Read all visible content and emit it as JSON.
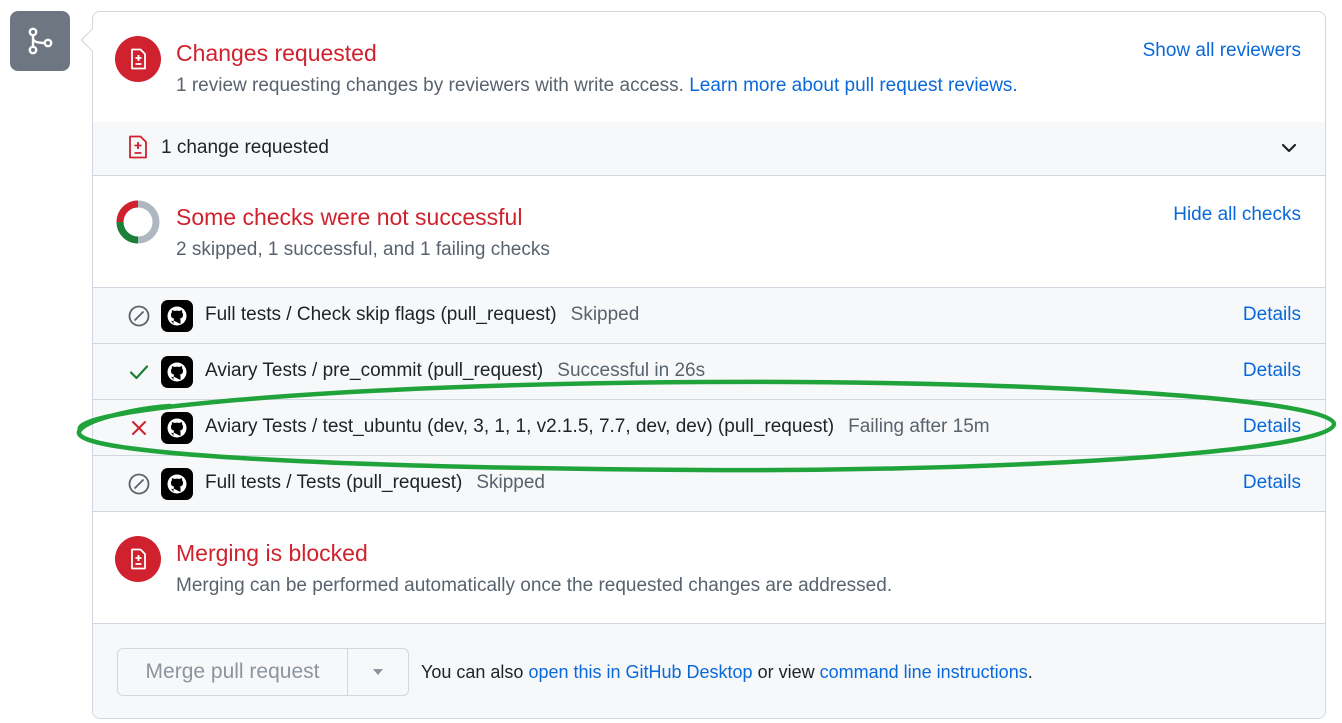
{
  "review": {
    "title": "Changes requested",
    "subtitle": "1 review requesting changes by reviewers with write access.",
    "learn_more": "Learn more about pull request reviews.",
    "show_all": "Show all reviewers",
    "changes_row": "1 change requested"
  },
  "checks_summary": {
    "title": "Some checks were not successful",
    "subtitle": "2 skipped, 1 successful, and 1 failing checks",
    "hide_all": "Hide all checks"
  },
  "checks": [
    {
      "name": "Full tests / Check skip flags (pull_request)",
      "note": "Skipped",
      "status": "skipped",
      "details": "Details"
    },
    {
      "name": "Aviary Tests / pre_commit (pull_request)",
      "note": "Successful in 26s",
      "status": "success",
      "details": "Details"
    },
    {
      "name": "Aviary Tests / test_ubuntu (dev, 3, 1, 1, v2.1.5, 7.7, dev, dev) (pull_request)",
      "note": "Failing after 15m",
      "status": "failure",
      "details": "Details"
    },
    {
      "name": "Full tests / Tests (pull_request)",
      "note": "Skipped",
      "status": "skipped",
      "details": "Details"
    }
  ],
  "blocked": {
    "title": "Merging is blocked",
    "subtitle": "Merging can be performed automatically once the requested changes are addressed."
  },
  "merge": {
    "button": "Merge pull request",
    "text_prefix": "You can also",
    "desktop_link": "open this in GitHub Desktop",
    "text_middle": "or view",
    "cli_link": "command line instructions",
    "text_suffix": "."
  },
  "colors": {
    "danger": "#cf222e",
    "success": "#1a7f37",
    "link": "#0969da",
    "highlight_ellipse": "#1fa33a"
  }
}
